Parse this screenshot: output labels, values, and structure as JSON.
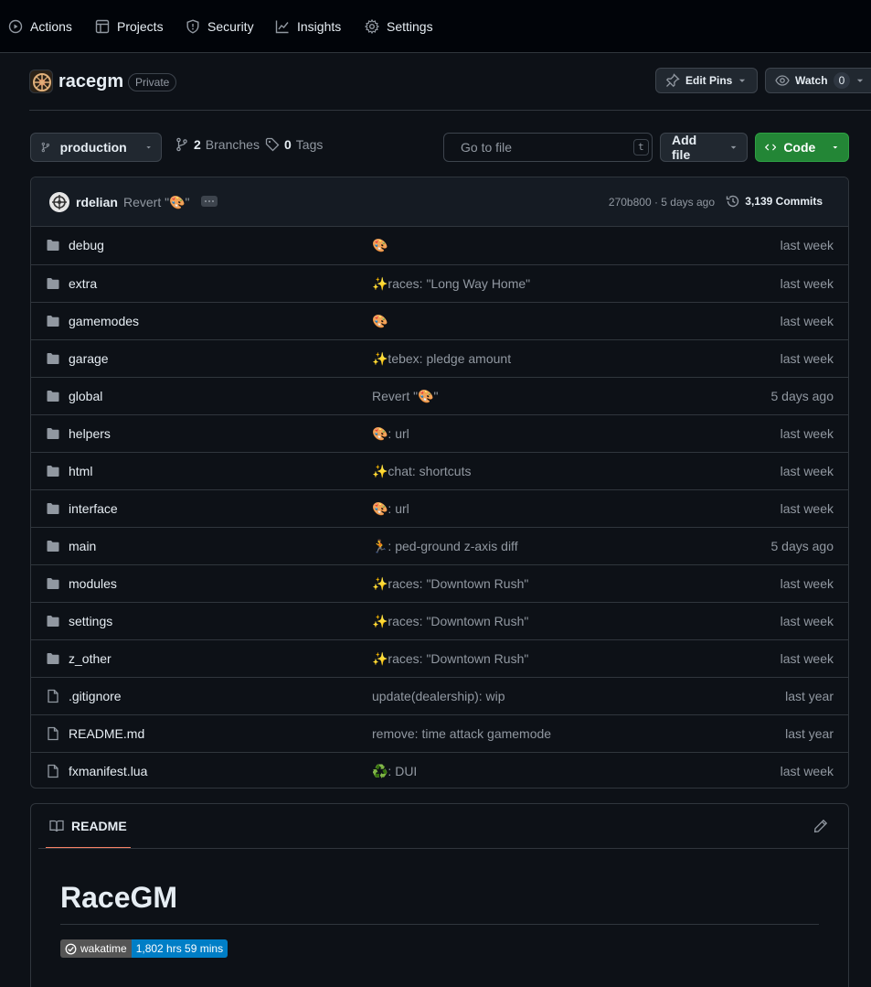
{
  "nav": {
    "items": [
      {
        "label": "Actions",
        "icon": "play-circle-icon"
      },
      {
        "label": "Projects",
        "icon": "table-icon"
      },
      {
        "label": "Security",
        "icon": "shield-icon"
      },
      {
        "label": "Insights",
        "icon": "graph-icon"
      },
      {
        "label": "Settings",
        "icon": "gear-icon"
      }
    ]
  },
  "repo": {
    "name": "racegm",
    "visibility": "Private",
    "edit_pins_label": "Edit Pins",
    "watch_label": "Watch",
    "watch_count": "0"
  },
  "toolbar": {
    "branch": "production",
    "branches_count": "2",
    "branches_label": "Branches",
    "tags_count": "0",
    "tags_label": "Tags",
    "search_placeholder": "Go to file",
    "search_shortcut": "t",
    "add_file_label": "Add file",
    "code_label": "Code"
  },
  "latest_commit": {
    "author": "rdelian",
    "message": "Revert \"🎨\"",
    "hash_and_age": "270b800 · 5 days ago",
    "commits_count": "3,139 Commits"
  },
  "files": [
    {
      "type": "dir",
      "name": "debug",
      "message": "🎨",
      "date": "last week"
    },
    {
      "type": "dir",
      "name": "extra",
      "message": "✨races: \"Long Way Home\"",
      "date": "last week"
    },
    {
      "type": "dir",
      "name": "gamemodes",
      "message": "🎨",
      "date": "last week"
    },
    {
      "type": "dir",
      "name": "garage",
      "message": "✨tebex: pledge amount",
      "date": "last week"
    },
    {
      "type": "dir",
      "name": "global",
      "message": "Revert \"🎨\"",
      "date": "5 days ago"
    },
    {
      "type": "dir",
      "name": "helpers",
      "message": "🎨: url",
      "date": "last week"
    },
    {
      "type": "dir",
      "name": "html",
      "message": "✨chat: shortcuts",
      "date": "last week"
    },
    {
      "type": "dir",
      "name": "interface",
      "message": "🎨: url",
      "date": "last week"
    },
    {
      "type": "dir",
      "name": "main",
      "message": "🏃: ped-ground z-axis diff",
      "date": "5 days ago"
    },
    {
      "type": "dir",
      "name": "modules",
      "message": "✨races: \"Downtown Rush\"",
      "date": "last week"
    },
    {
      "type": "dir",
      "name": "settings",
      "message": "✨races: \"Downtown Rush\"",
      "date": "last week"
    },
    {
      "type": "dir",
      "name": "z_other",
      "message": "✨races: \"Downtown Rush\"",
      "date": "last week"
    },
    {
      "type": "file",
      "name": ".gitignore",
      "message": "update(dealership): wip",
      "date": "last year"
    },
    {
      "type": "file",
      "name": "README.md",
      "message": "remove: time attack gamemode",
      "date": "last year"
    },
    {
      "type": "file",
      "name": "fxmanifest.lua",
      "message": "♻️: DUI",
      "date": "last week"
    }
  ],
  "readme": {
    "tab_label": "README",
    "heading": "RaceGM",
    "badge_left": "wakatime",
    "badge_right": "1,802 hrs 59 mins"
  },
  "colors": {
    "background": "#0d1117",
    "nav_background": "#010409",
    "code_button": "#238636",
    "readme_tab_underline": "#f78166",
    "badge_blue": "#007ec6"
  }
}
